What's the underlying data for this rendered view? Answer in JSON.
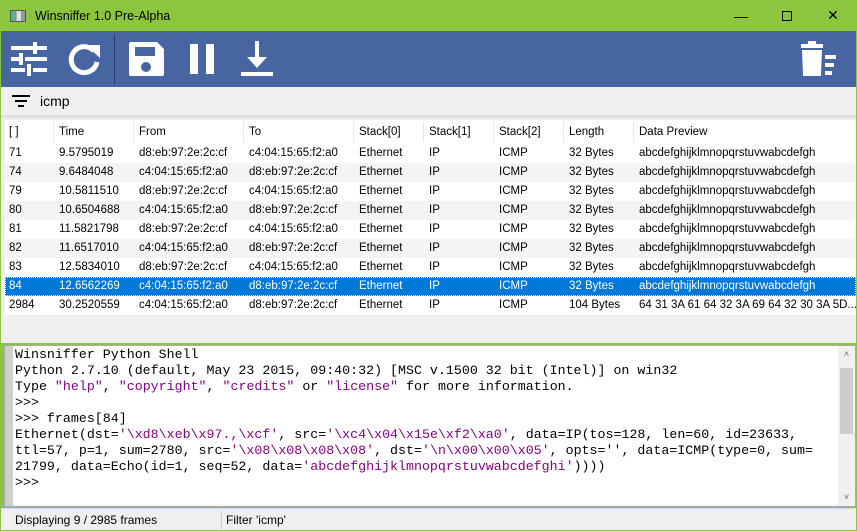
{
  "window": {
    "title": "Winsniffer 1.0 Pre-Alpha"
  },
  "toolbar": {
    "buttons": [
      "settings-icon",
      "refresh-icon",
      "save-icon",
      "pause-icon",
      "download-icon",
      "delete-icon"
    ]
  },
  "filter": {
    "value": "icmp"
  },
  "table": {
    "columns": [
      "[ ]",
      "Time",
      "From",
      "To",
      "Stack[0]",
      "Stack[1]",
      "Stack[2]",
      "Length",
      "Data Preview"
    ],
    "rows": [
      [
        "71",
        "9.5795019",
        "d8:eb:97:2e:2c:cf",
        "c4:04:15:65:f2:a0",
        "Ethernet",
        "IP",
        "ICMP",
        "32 Bytes",
        "abcdefghijklmnopqrstuvwabcdefgh"
      ],
      [
        "74",
        "9.6484048",
        "c4:04:15:65:f2:a0",
        "d8:eb:97:2e:2c:cf",
        "Ethernet",
        "IP",
        "ICMP",
        "32 Bytes",
        "abcdefghijklmnopqrstuvwabcdefgh"
      ],
      [
        "79",
        "10.5811510",
        "d8:eb:97:2e:2c:cf",
        "c4:04:15:65:f2:a0",
        "Ethernet",
        "IP",
        "ICMP",
        "32 Bytes",
        "abcdefghijklmnopqrstuvwabcdefgh"
      ],
      [
        "80",
        "10.6504688",
        "c4:04:15:65:f2:a0",
        "d8:eb:97:2e:2c:cf",
        "Ethernet",
        "IP",
        "ICMP",
        "32 Bytes",
        "abcdefghijklmnopqrstuvwabcdefgh"
      ],
      [
        "81",
        "11.5821798",
        "d8:eb:97:2e:2c:cf",
        "c4:04:15:65:f2:a0",
        "Ethernet",
        "IP",
        "ICMP",
        "32 Bytes",
        "abcdefghijklmnopqrstuvwabcdefgh"
      ],
      [
        "82",
        "11.6517010",
        "c4:04:15:65:f2:a0",
        "d8:eb:97:2e:2c:cf",
        "Ethernet",
        "IP",
        "ICMP",
        "32 Bytes",
        "abcdefghijklmnopqrstuvwabcdefgh"
      ],
      [
        "83",
        "12.5834010",
        "d8:eb:97:2e:2c:cf",
        "c4:04:15:65:f2:a0",
        "Ethernet",
        "IP",
        "ICMP",
        "32 Bytes",
        "abcdefghijklmnopqrstuvwabcdefgh"
      ],
      [
        "84",
        "12.6562269",
        "c4:04:15:65:f2:a0",
        "d8:eb:97:2e:2c:cf",
        "Ethernet",
        "IP",
        "ICMP",
        "32 Bytes",
        "abcdefghijklmnopqrstuvwabcdefgh"
      ],
      [
        "2984",
        "30.2520559",
        "c4:04:15:65:f2:a0",
        "d8:eb:97:2e:2c:cf",
        "Ethernet",
        "IP",
        "ICMP",
        "104 Bytes",
        "64 31 3A 61 64 32 3A 69 64 32 30 3A 5D..."
      ]
    ],
    "selected_row": 7
  },
  "shell": {
    "lines": [
      [
        [
          "Winsniffer Python Shell",
          ""
        ]
      ],
      [
        [
          "Python 2.7.10 (default, May 23 2015, 09:40:32) [MSC v.1500 32 bit (Intel)] on win32",
          ""
        ]
      ],
      [
        [
          "Type ",
          ""
        ],
        [
          "\"help\"",
          "s"
        ],
        [
          ", ",
          ""
        ],
        [
          "\"copyright\"",
          "s"
        ],
        [
          ", ",
          ""
        ],
        [
          "\"credits\"",
          "s"
        ],
        [
          " or ",
          ""
        ],
        [
          "\"license\"",
          "s"
        ],
        [
          " for more information.",
          ""
        ]
      ],
      [
        [
          ">>>",
          ""
        ]
      ],
      [
        [
          ">>> frames[84]",
          ""
        ]
      ],
      [
        [
          "Ethernet(dst=",
          ""
        ],
        [
          "'\\xd8\\xeb\\x97.,\\xcf'",
          "s"
        ],
        [
          ", src=",
          ""
        ],
        [
          "'\\xc4\\x04\\x15e\\xf2\\xa0'",
          "s"
        ],
        [
          ", data=IP(tos=128, len=60, id=23633,",
          ""
        ]
      ],
      [
        [
          "ttl=57, p=1, sum=2780, src=",
          ""
        ],
        [
          "'\\x08\\x08\\x08\\x08'",
          "s"
        ],
        [
          ", dst=",
          ""
        ],
        [
          "'\\n\\x00\\x00\\x05'",
          "s"
        ],
        [
          ", opts='', data=ICMP(type=0, sum=",
          ""
        ]
      ],
      [
        [
          "21799, data=Echo(id=1, seq=52, data=",
          ""
        ],
        [
          "'abcdefghijklmnopqrstuvwabcdefghi'",
          "s"
        ],
        [
          "))))",
          ""
        ]
      ],
      [
        [
          ">>>",
          ""
        ]
      ]
    ]
  },
  "status": {
    "count": "Displaying 9 / 2985 frames",
    "filter": "Filter 'icmp'"
  }
}
